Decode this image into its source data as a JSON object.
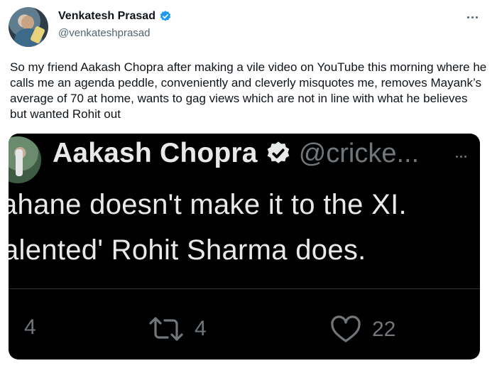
{
  "author": {
    "display_name": "Venkatesh Prasad",
    "handle": "@venkateshprasad"
  },
  "tweet_text": "So my friend Aakash Chopra after making a vile video on YouTube this morning where he calls me an agenda peddle,  conveniently and cleverly misquotes me, removes Mayank’s average of 70 at home, wants to gag views which are not in line with what he believes but wanted Rohit out",
  "embedded": {
    "display_name": "Aakash Chopra",
    "handle": "@cricke...",
    "line1": "ahane doesn't make it to the XI.",
    "line2": "alented' Rohit Sharma does.",
    "reply_count": "4",
    "retweet_count": "4",
    "like_count": "22"
  },
  "colors": {
    "verified_blue": "#1d9bf0",
    "embed_background": "#000000",
    "secondary_text": "#536471"
  },
  "icons": {
    "verified": "verified-badge-icon",
    "more": "more-options-icon",
    "reply": "reply-icon",
    "retweet": "retweet-icon",
    "like": "heart-icon"
  }
}
